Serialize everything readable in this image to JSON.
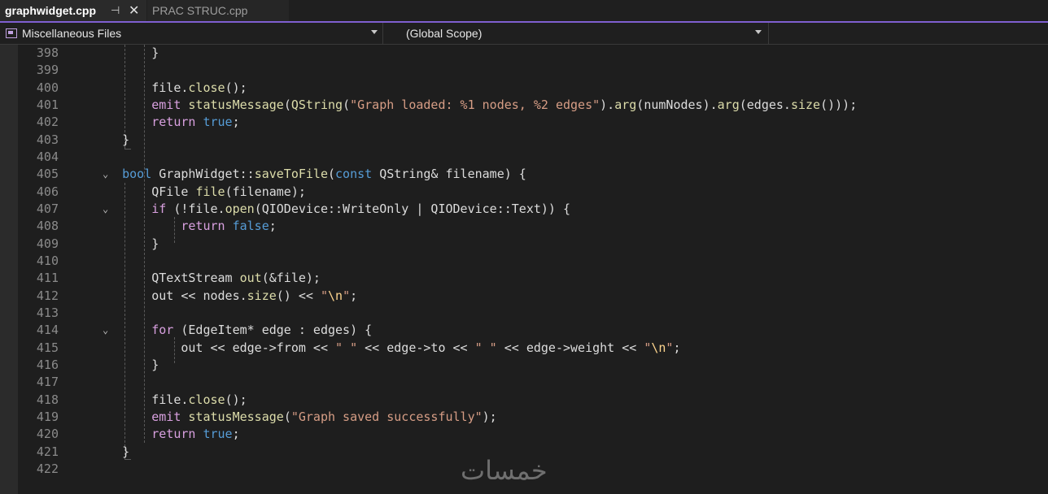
{
  "tabs": [
    {
      "label": "graphwidget.cpp",
      "active": true,
      "pinned": true
    },
    {
      "label": "PRAC STRUC.cpp",
      "active": false
    }
  ],
  "navbar": {
    "project": "Miscellaneous Files",
    "scope": "(Global Scope)"
  },
  "editor": {
    "lines": [
      {
        "n": "398",
        "html": "        }"
      },
      {
        "n": "399",
        "html": ""
      },
      {
        "n": "400",
        "html": "        file.close();"
      },
      {
        "n": "401",
        "html": "        emit statusMessage(QString(\"Graph loaded: %1 nodes, %2 edges\").arg(numNodes).arg(edges.size()));"
      },
      {
        "n": "402",
        "html": "        return true;"
      },
      {
        "n": "403",
        "html": "    }"
      },
      {
        "n": "404",
        "html": ""
      },
      {
        "n": "405",
        "html": "    bool GraphWidget::saveToFile(const QString& filename) {"
      },
      {
        "n": "406",
        "html": "        QFile file(filename);"
      },
      {
        "n": "407",
        "html": "        if (!file.open(QIODevice::WriteOnly | QIODevice::Text)) {"
      },
      {
        "n": "408",
        "html": "            return false;"
      },
      {
        "n": "409",
        "html": "        }"
      },
      {
        "n": "410",
        "html": ""
      },
      {
        "n": "411",
        "html": "        QTextStream out(&file);"
      },
      {
        "n": "412",
        "html": "        out << nodes.size() << \"\\n\";"
      },
      {
        "n": "413",
        "html": ""
      },
      {
        "n": "414",
        "html": "        for (EdgeItem* edge : edges) {"
      },
      {
        "n": "415",
        "html": "            out << edge->from << \" \" << edge->to << \" \" << edge->weight << \"\\n\";"
      },
      {
        "n": "416",
        "html": "        }"
      },
      {
        "n": "417",
        "html": ""
      },
      {
        "n": "418",
        "html": "        file.close();"
      },
      {
        "n": "419",
        "html": "        emit statusMessage(\"Graph saved successfully\");"
      },
      {
        "n": "420",
        "html": "        return true;"
      },
      {
        "n": "421",
        "html": "    }"
      },
      {
        "n": "422",
        "html": ""
      }
    ],
    "fold_lines": [
      "405",
      "407",
      "414"
    ]
  },
  "watermark": "خمسات",
  "colors": {
    "keyword": "#569cd6",
    "control_keyword": "#d8a0df",
    "string": "#d69d85",
    "escape": "#ffd68f",
    "text": "#dcdcdc",
    "accent": "#7f5fd0"
  }
}
